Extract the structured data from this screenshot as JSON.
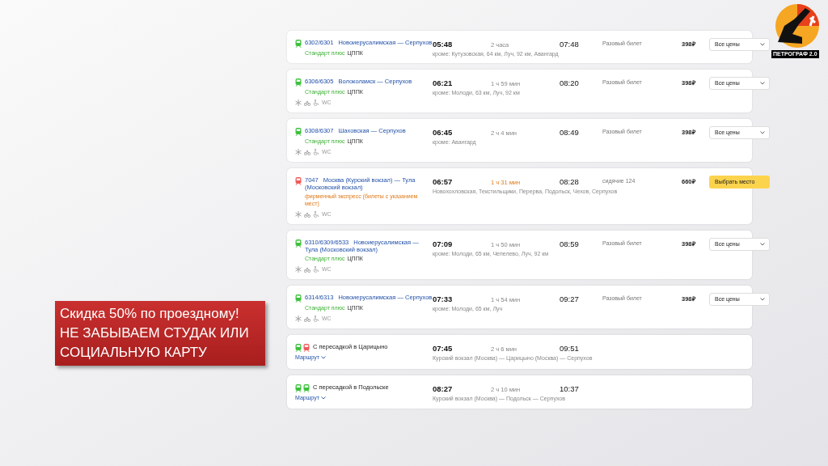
{
  "logo": {
    "text": "ПЕТРОГРАФ 2.0"
  },
  "callout": {
    "lines": [
      "Скидка 50% по проездному!",
      "НЕ ЗАБЫВАЕМ СТУДАК ИЛИ",
      "СОЦИАЛЬНУЮ КАРТУ"
    ]
  },
  "trips": [
    {
      "kind": "train",
      "number": "6302/6301",
      "route": "Новоиерусалимская — Серпухов",
      "category": "Стандарт плюс",
      "carrier": "ЦППК",
      "express": false,
      "color": "#3cc13b",
      "departure": "05:48",
      "duration": "2 часа",
      "arrival": "07:48",
      "stops": "кроме: Кутузовская, 64 км, Луч, 92 км, Авангард",
      "ticket": "Разовый билет",
      "price": "398₽",
      "action": {
        "kind": "dropdown",
        "label": "Все цены"
      }
    },
    {
      "kind": "train",
      "number": "6306/6305",
      "route": "Волоколамск — Серпухов",
      "category": "Стандарт плюс",
      "carrier": "ЦППК",
      "express": false,
      "color": "#3cc13b",
      "amenities": {
        "wc": "WC"
      },
      "departure": "06:21",
      "duration": "1 ч 59 мин",
      "arrival": "08:20",
      "stops": "кроме: Молоди, 63 км, Луч, 92 км",
      "ticket": "Разовый билет",
      "price": "398₽",
      "action": {
        "kind": "dropdown",
        "label": "Все цены"
      }
    },
    {
      "kind": "train",
      "number": "6308/6307",
      "route": "Шаховская — Серпухов",
      "category": "Стандарт плюс",
      "carrier": "ЦППК",
      "express": false,
      "color": "#3cc13b",
      "amenities": {
        "wc": "WC"
      },
      "departure": "06:45",
      "duration": "2 ч 4 мин",
      "arrival": "08:49",
      "stops": "кроме: Авангард",
      "ticket": "Разовый билет",
      "price": "398₽",
      "action": {
        "kind": "dropdown",
        "label": "Все цены"
      }
    },
    {
      "kind": "train",
      "number": "7047",
      "route": "Москва (Курский вокзал) — Тула (Московский вокзал)",
      "category": "фирменный экспресс (билеты с указанием мест)",
      "express": true,
      "color": "#f05a5a",
      "amenities": {
        "wc": "WC"
      },
      "departure": "06:57",
      "duration": "1 ч 31 мин",
      "arrival": "08:28",
      "stops": "Новохохловская, Текстильщики, Перерва, Подольск, Чехов, Серпухов",
      "ticket": "сидячие 124",
      "price": "660₽",
      "action": {
        "kind": "select",
        "label": "Выбрать место"
      }
    },
    {
      "kind": "train",
      "number": "6310/6309/6533",
      "route": "Новоиерусалимская — Тула (Московский вокзал)",
      "category": "Стандарт плюс",
      "carrier": "ЦППК",
      "express": false,
      "color": "#3cc13b",
      "amenities": {
        "wc": "WC"
      },
      "departure": "07:09",
      "duration": "1 ч 50 мин",
      "arrival": "08:59",
      "stops": "кроме: Молоди, 65 км, Чепелево, Луч, 92 км",
      "ticket": "Разовый билет",
      "price": "398₽",
      "action": {
        "kind": "dropdown",
        "label": "Все цены"
      }
    },
    {
      "kind": "train",
      "number": "6314/6313",
      "route": "Новоиерусалимская — Серпухов",
      "category": "Стандарт плюс",
      "carrier": "ЦППК",
      "express": false,
      "color": "#3cc13b",
      "amenities": {
        "wc": "WC"
      },
      "departure": "07:33",
      "duration": "1 ч 54 мин",
      "arrival": "09:27",
      "stops": "кроме: Молоди, 65 км, Луч",
      "ticket": "Разовый билет",
      "price": "398₽",
      "action": {
        "kind": "dropdown",
        "label": "Все цены"
      }
    },
    {
      "kind": "transfer",
      "title": "С пересадкой в Царицыно",
      "link": "Маршрут",
      "icons": [
        {
          "color": "#3cc13b"
        },
        {
          "color": "#f05a5a"
        }
      ],
      "departure": "07:45",
      "duration": "2 ч 6 мин",
      "arrival": "09:51",
      "stops": "Курский вокзал (Москва) — Царицыно (Москва) — Серпухов"
    },
    {
      "kind": "transfer",
      "title": "С пересадкой в Подольске",
      "link": "Маршрут",
      "icons": [
        {
          "color": "#3cc13b"
        },
        {
          "color": "#3cc13b"
        }
      ],
      "departure": "08:27",
      "duration": "2 ч 10 мин",
      "arrival": "10:37",
      "stops": "Курский вокзал (Москва) — Подольск — Серпухов"
    }
  ]
}
